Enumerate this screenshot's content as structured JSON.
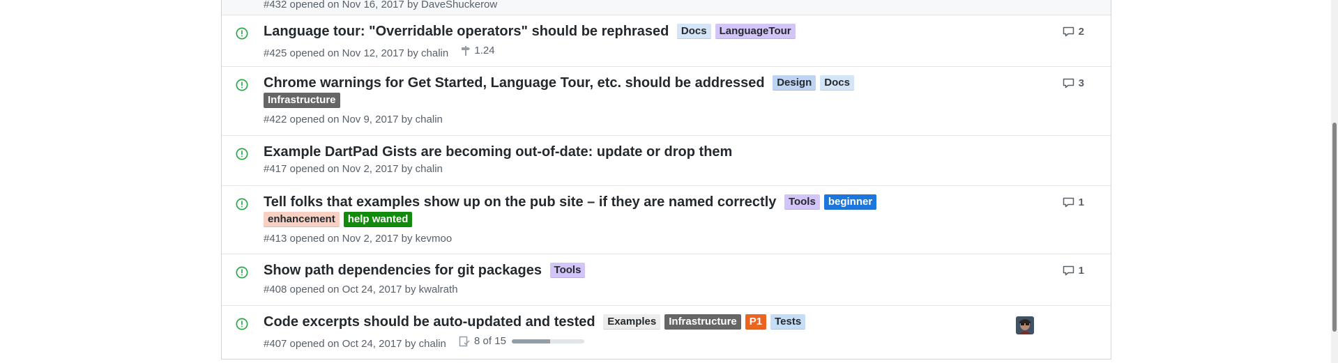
{
  "colors": {
    "open_icon": "#28a745",
    "meta_text": "#586069",
    "title_text": "#24292e"
  },
  "issues": [
    {
      "meta_text": "#432 opened on Nov 16, 2017 by DaveShuckerow"
    },
    {
      "title": "Language tour: \"Overridable operators\" should be rephrased",
      "labels": [
        {
          "text": "Docs",
          "bg": "#d4e5f7",
          "fg": "#24292e"
        },
        {
          "text": "LanguageTour",
          "bg": "#d4c5f9",
          "fg": "#24292e"
        }
      ],
      "meta_text": "#425 opened on Nov 12, 2017 by chalin",
      "milestone": "1.24",
      "comments": "2",
      "icon": "open-issue-icon"
    },
    {
      "title": "Chrome warnings for Get Started, Language Tour, etc. should be addressed",
      "labels": [
        {
          "text": "Design",
          "bg": "#bfd4f2",
          "fg": "#24292e"
        },
        {
          "text": "Docs",
          "bg": "#d4e5f7",
          "fg": "#24292e"
        },
        {
          "text": "Infrastructure",
          "bg": "#666666",
          "fg": "#ffffff"
        }
      ],
      "meta_text": "#422 opened on Nov 9, 2017 by chalin",
      "comments": "3",
      "icon": "open-issue-icon"
    },
    {
      "title": "Example DartPad Gists are becoming out-of-date: update or drop them",
      "meta_text": "#417 opened on Nov 2, 2017 by chalin",
      "icon": "open-issue-icon"
    },
    {
      "title": "Tell folks that examples show up on the pub site – if they are named correctly",
      "labels": [
        {
          "text": "Tools",
          "bg": "#d4c5f9",
          "fg": "#24292e"
        },
        {
          "text": "beginner",
          "bg": "#1d76db",
          "fg": "#ffffff"
        },
        {
          "text": "enhancement",
          "bg": "#f9d0c4",
          "fg": "#24292e"
        },
        {
          "text": "help wanted",
          "bg": "#128a0c",
          "fg": "#ffffff"
        }
      ],
      "meta_text": "#413 opened on Nov 2, 2017 by kevmoo",
      "comments": "1",
      "icon": "open-issue-icon"
    },
    {
      "title": "Show path dependencies for git packages",
      "labels": [
        {
          "text": "Tools",
          "bg": "#d4c5f9",
          "fg": "#24292e"
        }
      ],
      "meta_text": "#408 opened on Oct 24, 2017 by kwalrath",
      "comments": "1",
      "icon": "open-issue-icon"
    },
    {
      "title": "Code excerpts should be auto-updated and tested",
      "labels": [
        {
          "text": "Examples",
          "bg": "#ededed",
          "fg": "#24292e"
        },
        {
          "text": "Infrastructure",
          "bg": "#666666",
          "fg": "#ffffff"
        },
        {
          "text": "P1",
          "bg": "#eb6420",
          "fg": "#ffffff"
        },
        {
          "text": "Tests",
          "bg": "#c5def5",
          "fg": "#24292e"
        }
      ],
      "meta_text": "#407 opened on Oct 24, 2017 by chalin",
      "tasks": "8 of 15",
      "task_progress": 0.53,
      "assignee_avatar": "avatar",
      "icon": "open-issue-icon"
    }
  ]
}
